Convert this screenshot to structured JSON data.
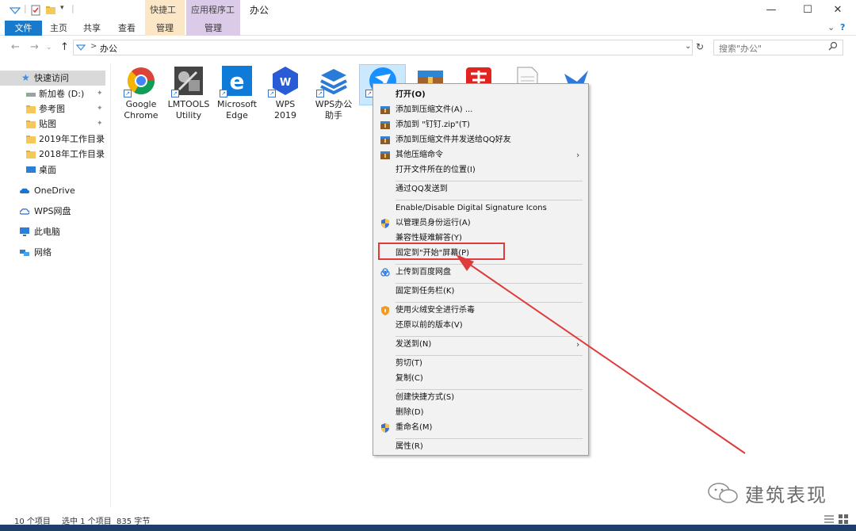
{
  "window": {
    "title": "办公",
    "minimize": "—",
    "maximize": "☐",
    "close": "✕"
  },
  "ribbon": {
    "context_quick": "快捷工具",
    "context_app": "应用程序工具",
    "tabs": [
      "文件",
      "主页",
      "共享",
      "查看",
      "管理",
      "管理"
    ],
    "expand": "⌄",
    "help": "?"
  },
  "address": {
    "path": "办公",
    "sep": ">",
    "dropdown": "⌄",
    "refresh": "↻",
    "back": "←",
    "forward": "→",
    "recent": "⌄",
    "up": "↑"
  },
  "search": {
    "placeholder": "搜索\"办公\""
  },
  "sidebar": {
    "items": [
      {
        "label": "快速访问",
        "icon": "star-icon"
      },
      {
        "label": "新加卷 (D:)",
        "icon": "drive-icon",
        "pinned": true
      },
      {
        "label": "参考图",
        "icon": "folder-icon",
        "pinned": true
      },
      {
        "label": "贴图",
        "icon": "folder-icon",
        "pinned": true
      },
      {
        "label": "2019年工作目录",
        "icon": "folder-icon",
        "pinned": true
      },
      {
        "label": "2018年工作目录",
        "icon": "folder-icon",
        "pinned": true
      },
      {
        "label": "桌面",
        "icon": "desktop-icon"
      },
      {
        "label": "OneDrive",
        "icon": "cloud-icon"
      },
      {
        "label": "WPS网盘",
        "icon": "cloud-icon"
      },
      {
        "label": "此电脑",
        "icon": "computer-icon"
      },
      {
        "label": "网络",
        "icon": "network-icon"
      }
    ],
    "pin": "📌"
  },
  "files": [
    {
      "label1": "Google",
      "label2": "Chrome",
      "icon": "chrome-icon"
    },
    {
      "label1": "LMTOOLS",
      "label2": "Utility",
      "icon": "lmtools-icon"
    },
    {
      "label1": "Microsoft",
      "label2": "Edge",
      "icon": "edge-icon"
    },
    {
      "label1": "WPS 2019",
      "label2": "",
      "icon": "wps-icon"
    },
    {
      "label1": "WPS办公",
      "label2": "助手",
      "icon": "wps-assistant-icon"
    },
    {
      "label1": "",
      "label2": "",
      "icon": "dingtalk-icon"
    },
    {
      "label1": "",
      "label2": "",
      "icon": "archive-icon"
    },
    {
      "label1": "",
      "label2": "",
      "icon": "app-red-icon"
    },
    {
      "label1": "",
      "label2": "",
      "icon": "document-icon"
    },
    {
      "label1": "",
      "label2": "",
      "icon": "bird-icon"
    }
  ],
  "context_menu": {
    "items": [
      "打开(O)",
      "添加到压缩文件(A) ...",
      "添加到 \"钉钉.zip\"(T)",
      "添加到压缩文件并发送给QQ好友",
      "其他压缩命令",
      "打开文件所在的位置(I)",
      "通过QQ发送到",
      "Enable/Disable Digital Signature Icons",
      "以管理员身份运行(A)",
      "兼容性疑难解答(Y)",
      "固定到\"开始\"屏幕(P)",
      "上传到百度网盘",
      "固定到任务栏(K)",
      "使用火绒安全进行杀毒",
      "还原以前的版本(V)",
      "发送到(N)",
      "剪切(T)",
      "复制(C)",
      "创建快捷方式(S)",
      "删除(D)",
      "重命名(M)",
      "属性(R)"
    ],
    "submenu_arrow": "›"
  },
  "status": {
    "count": "10 个项目",
    "selected": "选中 1 个项目",
    "size": "835 字节"
  },
  "watermark": {
    "text": "建筑表现"
  },
  "colors": {
    "accent": "#1979ca",
    "highlight": "#e03b3b",
    "quick_tools": "#fbe7c6",
    "app_tools": "#dccbe8"
  }
}
